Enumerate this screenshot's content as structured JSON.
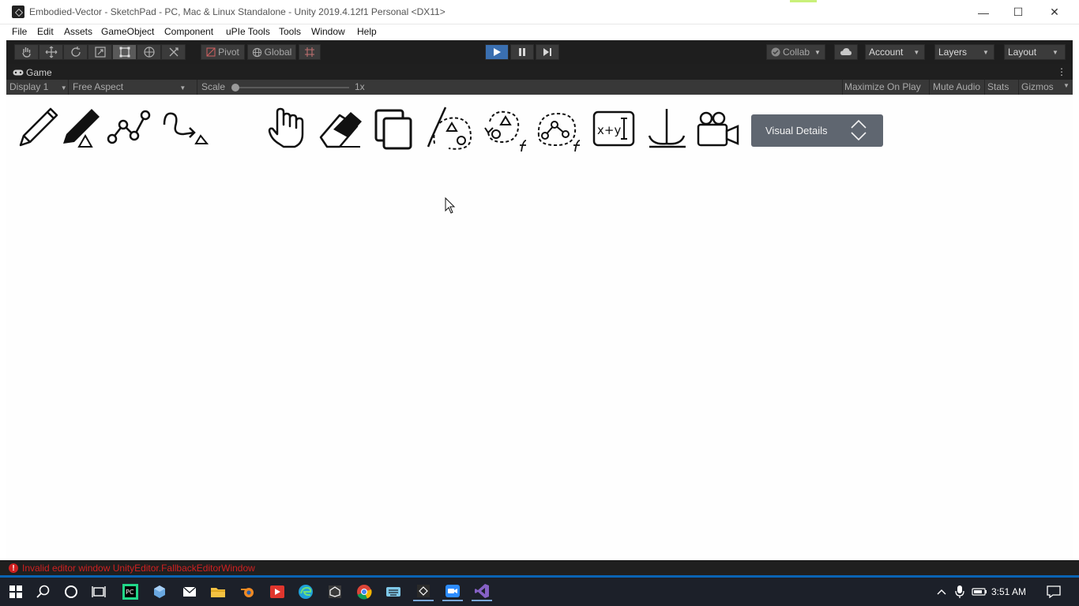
{
  "window": {
    "title": "Embodied-Vector - SketchPad - PC, Mac & Linux Standalone - Unity 2019.4.12f1 Personal <DX11>",
    "minimize_glyph": "—",
    "maximize_glyph": "☐",
    "close_glyph": "✕"
  },
  "menu": {
    "items": [
      "File",
      "Edit",
      "Assets",
      "GameObject",
      "Component",
      "uPIe Tools",
      "Tools",
      "Window",
      "Help"
    ]
  },
  "toolbar": {
    "pivot_label": "Pivot",
    "global_label": "Global",
    "collab_label": "Collab",
    "account_label": "Account",
    "layers_label": "Layers",
    "layout_label": "Layout"
  },
  "game_tab": {
    "label": "Game"
  },
  "game_options": {
    "display": "Display 1",
    "aspect": "Free Aspect",
    "scale_label": "Scale",
    "scale_value": "1x",
    "maximize_on_play": "Maximize On Play",
    "mute_audio": "Mute Audio",
    "stats": "Stats",
    "gizmos": "Gizmos"
  },
  "sketch_tools": [
    {
      "name": "pencil-icon"
    },
    {
      "name": "marker-icon"
    },
    {
      "name": "polyline-icon"
    },
    {
      "name": "path-arrow-icon"
    },
    {
      "name": "hand-icon"
    },
    {
      "name": "eraser-icon"
    },
    {
      "name": "copy-icon"
    },
    {
      "name": "lasso-brush-icon"
    },
    {
      "name": "rotate-function-icon"
    },
    {
      "name": "graph-function-icon"
    },
    {
      "name": "equation-input-icon"
    },
    {
      "name": "anchor-axis-icon"
    },
    {
      "name": "camera-icon"
    }
  ],
  "visual_details": {
    "label": "Visual Details"
  },
  "status": {
    "error_text": "Invalid editor window UnityEditor.FallbackEditorWindow"
  },
  "taskbar": {
    "time": "3:51 AM"
  },
  "colors": {
    "play_button": "#3a6fb0",
    "error_red": "#d02020",
    "visual_details_bg": "#5f6670",
    "taskbar_accent": "#0a64b4"
  }
}
